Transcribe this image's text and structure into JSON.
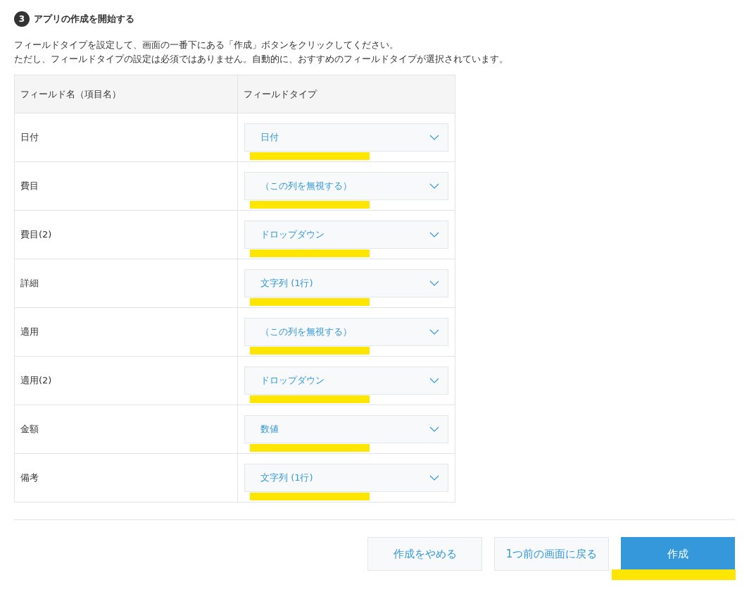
{
  "section": {
    "step": "3",
    "title": "アプリの作成を開始する",
    "description": [
      "フィールドタイプを設定して、画面の一番下にある「作成」ボタンをクリックしてください。",
      "ただし、フィールドタイプの設定は必須ではありません。自動的に、おすすめのフィールドタイプが選択されています。"
    ]
  },
  "table": {
    "columns": [
      "フィールド名（項目名）",
      "フィールドタイプ"
    ],
    "rows": [
      {
        "field": "日付",
        "type": "日付",
        "highlighted": true
      },
      {
        "field": "費目",
        "type": "（この列を無視する）",
        "highlighted": true
      },
      {
        "field": "費目(2)",
        "type": "ドロップダウン",
        "highlighted": true
      },
      {
        "field": "詳細",
        "type": "文字列 (1行)",
        "highlighted": true
      },
      {
        "field": "適用",
        "type": "（この列を無視する）",
        "highlighted": true
      },
      {
        "field": "適用(2)",
        "type": "ドロップダウン",
        "highlighted": true
      },
      {
        "field": "金額",
        "type": "数値",
        "highlighted": true
      },
      {
        "field": "備考",
        "type": "文字列 (1行)",
        "highlighted": true
      }
    ]
  },
  "buttons": [
    {
      "label": "作成をやめる",
      "kind": "secondary",
      "highlighted": false
    },
    {
      "label": "1つ前の画面に戻る",
      "kind": "secondary",
      "highlighted": false
    },
    {
      "label": "作成",
      "kind": "primary",
      "highlighted": true
    }
  ]
}
